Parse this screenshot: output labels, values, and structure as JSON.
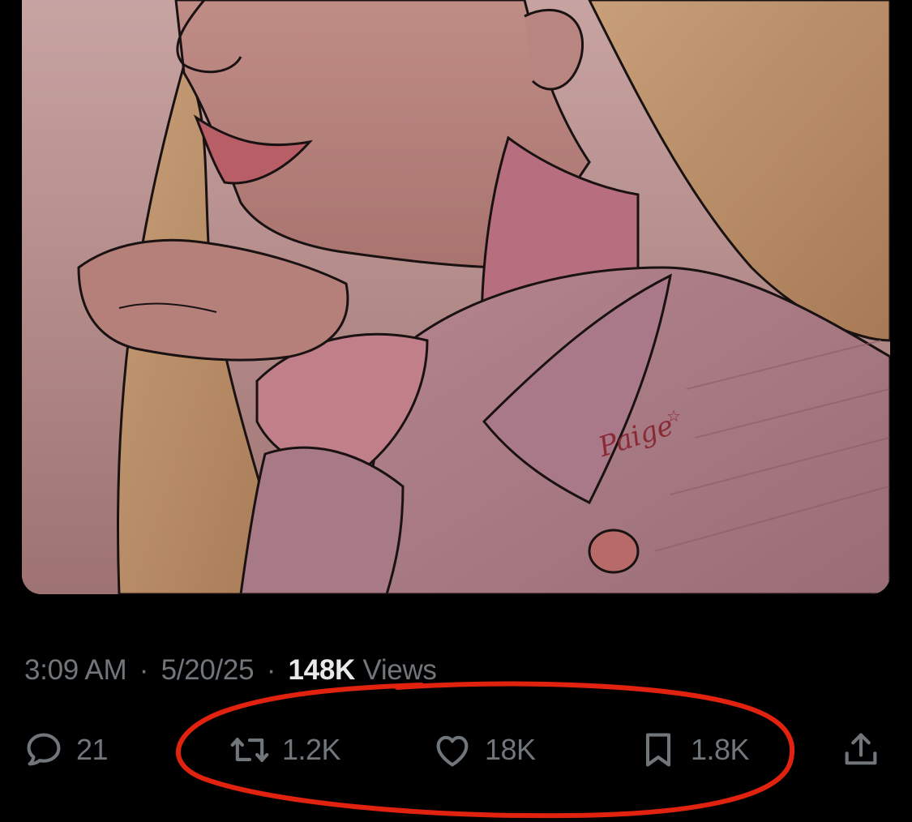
{
  "post": {
    "time": "3:09 AM",
    "date": "5/20/25",
    "views_count": "148K",
    "views_label": "Views",
    "separator": "·"
  },
  "media": {
    "signature": "Paige"
  },
  "actions": {
    "reply_count": "21",
    "repost_count": "1.2K",
    "like_count": "18K",
    "bookmark_count": "1.8K"
  },
  "icons": {
    "reply": "speech-bubble-icon",
    "repost": "repost-arrows-icon",
    "like": "heart-icon",
    "bookmark": "bookmark-icon",
    "share": "share-upload-icon"
  },
  "colors": {
    "background": "#000000",
    "muted_text": "#71767b",
    "strong_text": "#e7e9ea",
    "annotation": "#e0220e"
  }
}
